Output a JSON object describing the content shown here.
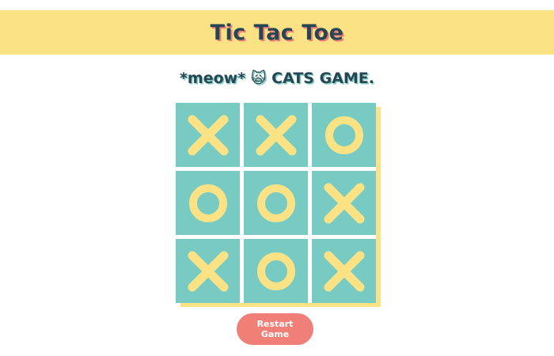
{
  "header": {
    "title": "Tic Tac Toe"
  },
  "status": {
    "text": "*meow* 🙀 CATS GAME."
  },
  "board": {
    "cells": [
      "X",
      "X",
      "O",
      "O",
      "O",
      "X",
      "X",
      "O",
      "X"
    ],
    "cell_icons": {
      "X": "x-mark-icon",
      "O": "o-mark-icon"
    }
  },
  "restart": {
    "label": "Restart Game"
  },
  "colors": {
    "header_bg": "#fbe385",
    "title_text": "#264653",
    "title_shadow": "#f07f78",
    "cell_bg": "#78cbc2",
    "mark": "#fbe385",
    "button_bg": "#f07f78",
    "button_text": "#ffffff"
  }
}
